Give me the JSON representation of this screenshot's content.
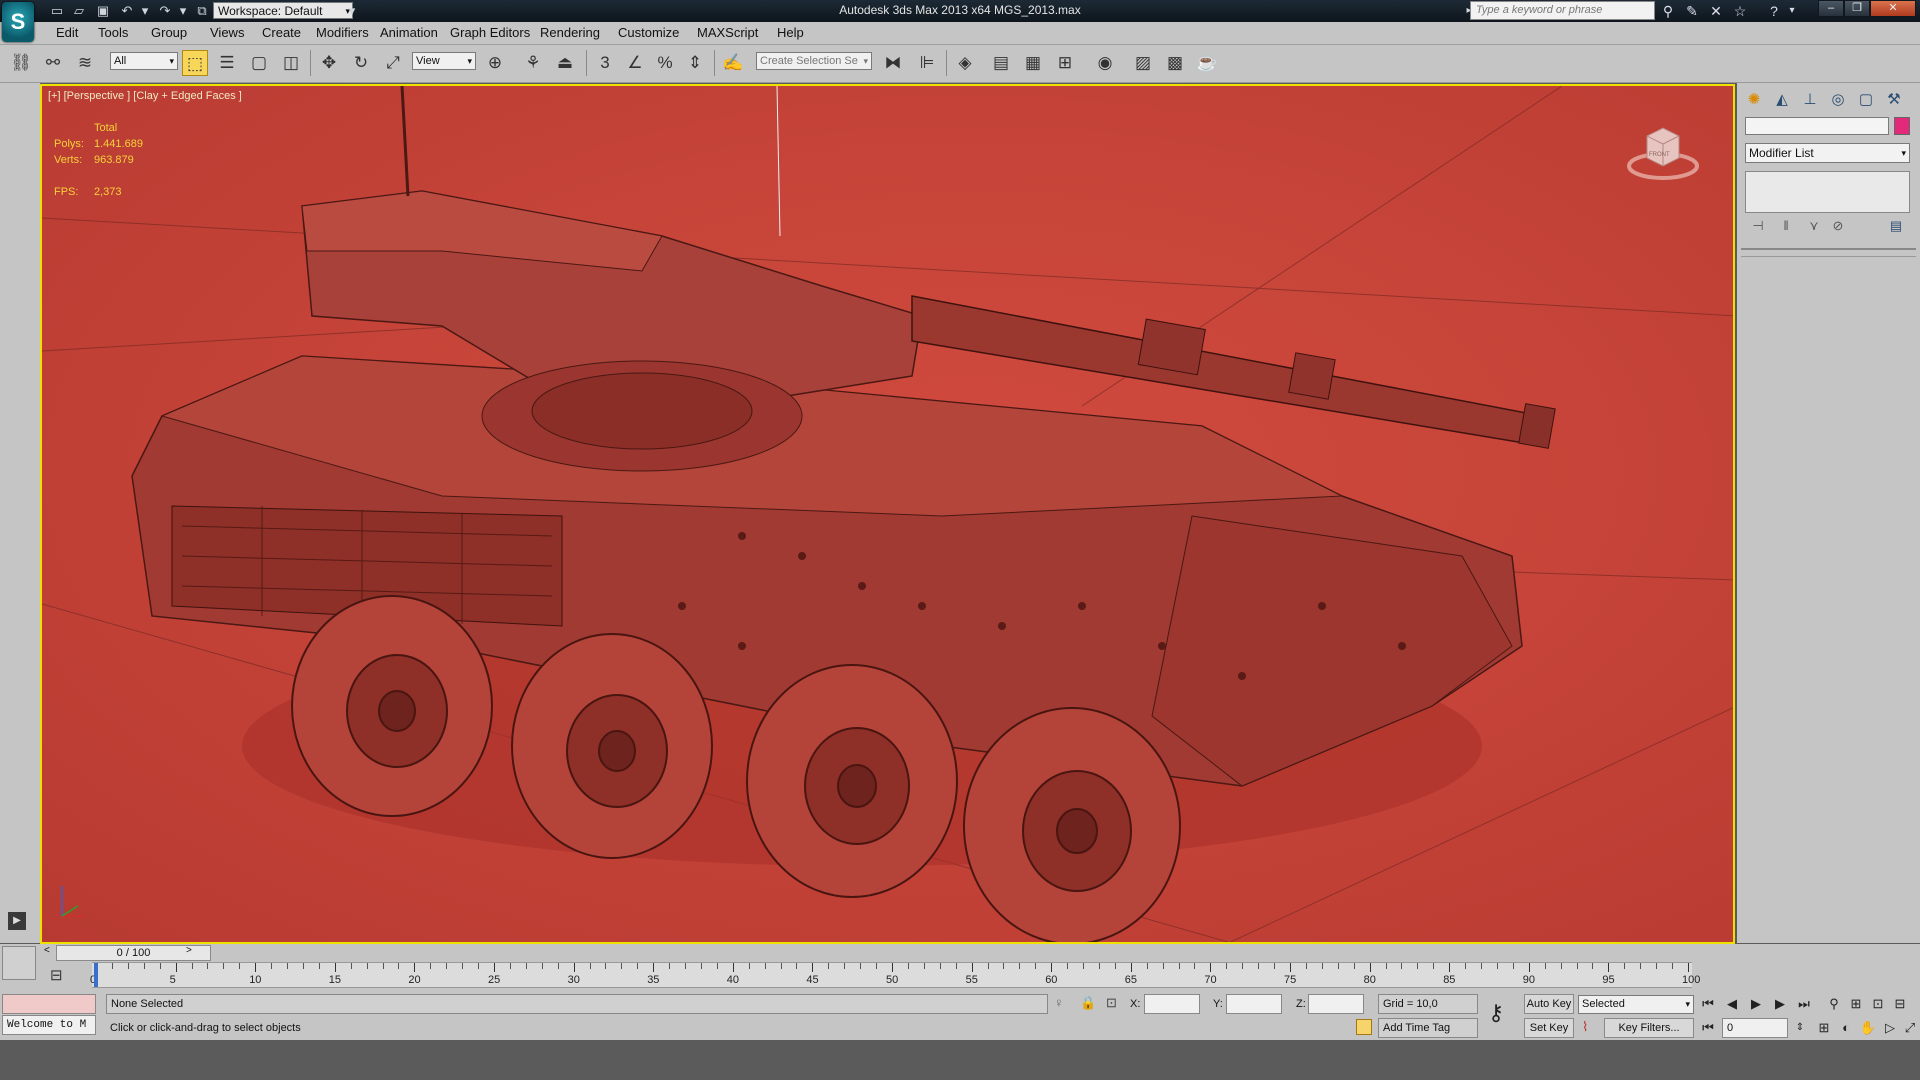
{
  "app": {
    "title": "Autodesk 3ds Max  2013 x64      MGS_2013.max",
    "workspace_label": "Workspace: Default",
    "search_placeholder": "Type a keyword or phrase"
  },
  "menu": [
    "Edit",
    "Tools",
    "Group",
    "Views",
    "Create",
    "Modifiers",
    "Animation",
    "Graph Editors",
    "Rendering",
    "Customize",
    "MAXScript",
    "Help"
  ],
  "toolbar": {
    "filter_value": "All",
    "refcoord_value": "View",
    "selection_set_placeholder": "Create Selection Se",
    "snap_label": "3",
    "angle_snap_label": "",
    "percent_snap_label": "%"
  },
  "viewport": {
    "label": "[+] [Perspective ] [Clay + Edged Faces ]",
    "stats_heading": "Total",
    "polys_label": "Polys:",
    "polys_value": "1.441.689",
    "verts_label": "Verts:",
    "verts_value": "963.879",
    "fps_label": "FPS:",
    "fps_value": "2,373",
    "viewcube_label": "FRONT",
    "background_color": "#c8453a",
    "border_color": "#f0e000"
  },
  "command_panel": {
    "modifier_list_label": "Modifier List"
  },
  "timeline": {
    "frame_display": "0 / 100",
    "ticks": [
      "0",
      "5",
      "10",
      "15",
      "20",
      "25",
      "30",
      "35",
      "40",
      "45",
      "50",
      "55",
      "60",
      "65",
      "70",
      "75",
      "80",
      "85",
      "90",
      "95",
      "100"
    ]
  },
  "status": {
    "selection": "None Selected",
    "prompt": "Click or click-and-drag to select objects",
    "maxscript_listener": "Welcome to M",
    "x_label": "X:",
    "y_label": "Y:",
    "z_label": "Z:",
    "grid": "Grid = 10,0",
    "add_time_tag": "Add Time Tag",
    "auto_key": "Auto Key",
    "set_key": "Set Key",
    "key_mode_value": "Selected",
    "key_filters": "Key Filters...",
    "current_frame": "0"
  }
}
